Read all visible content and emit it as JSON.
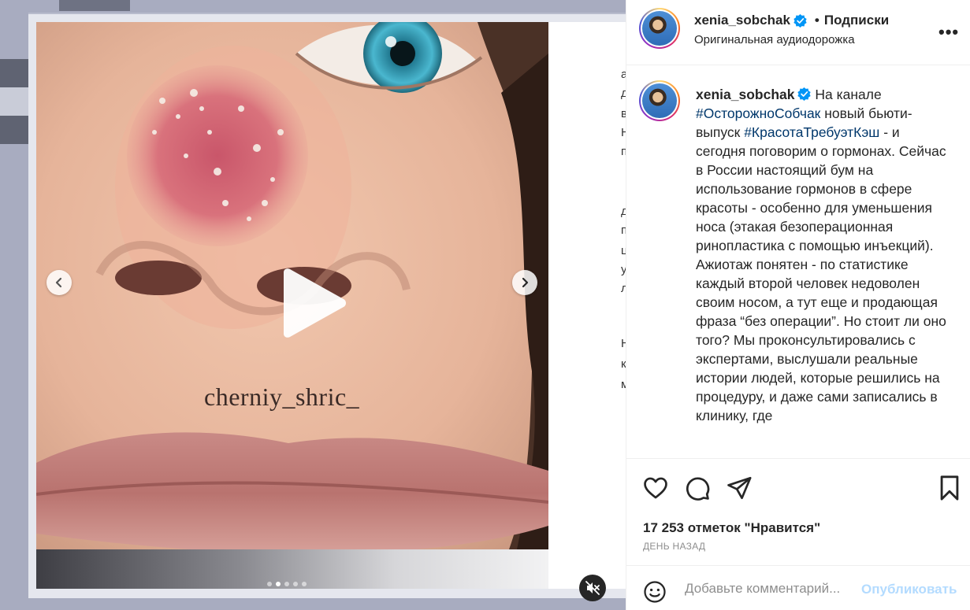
{
  "post": {
    "username": "xenia_sobchak",
    "bullet": "•",
    "follow_label": "Подписки",
    "audio_label": "Оригинальная аудиодорожка",
    "more_label": "•••"
  },
  "caption": {
    "username": "xenia_sobchak",
    "part1": "На канале ",
    "hashtag1": "#ОсторожноСобчак",
    "part2": " новый бьюти-выпуск ",
    "hashtag2": "#КрасотаТребуэтКэш",
    "part3": " - и сегодня поговорим о гормонах. Сейчас в России настоящий бум на использование гормонов в сфере красоты - особенно для уменьшения носа (этакая безоперационная ринопластика с помощью инъекций). Ажиотаж понятен - по статистике каждый второй человек недоволен своим носом, а тут еще и продающая фраза “без операции”. Но стоит ли оно того? Мы проконсультировались с экспертами, выслушали реальные истории людей, которые решились на процедуру, и даже сами записались в клинику, где"
  },
  "media": {
    "watermark": "cherniy_shric_",
    "carousel_total": 5,
    "carousel_active_index": 1,
    "side_glyphs": [
      "a",
      "д",
      "в",
      "Н",
      "п",
      "д",
      "п",
      "ц",
      "у",
      "л",
      "Н",
      "к",
      "м"
    ]
  },
  "stats": {
    "likes": "17 253 отметок \"Нравится\"",
    "date": "ДЕНЬ НАЗАД"
  },
  "comment": {
    "placeholder": "Добавьте комментарий...",
    "publish_label": "Опубликовать"
  },
  "colors": {
    "hashtag": "#00376b",
    "publish_disabled": "#b3dbff",
    "verified": "#0095f6"
  },
  "icons": [
    "heart-icon",
    "comment-icon",
    "share-icon",
    "bookmark-icon",
    "emoji-icon",
    "verified-icon",
    "play-icon",
    "chevron-left-icon",
    "chevron-right-icon",
    "mute-icon",
    "more-icon"
  ]
}
